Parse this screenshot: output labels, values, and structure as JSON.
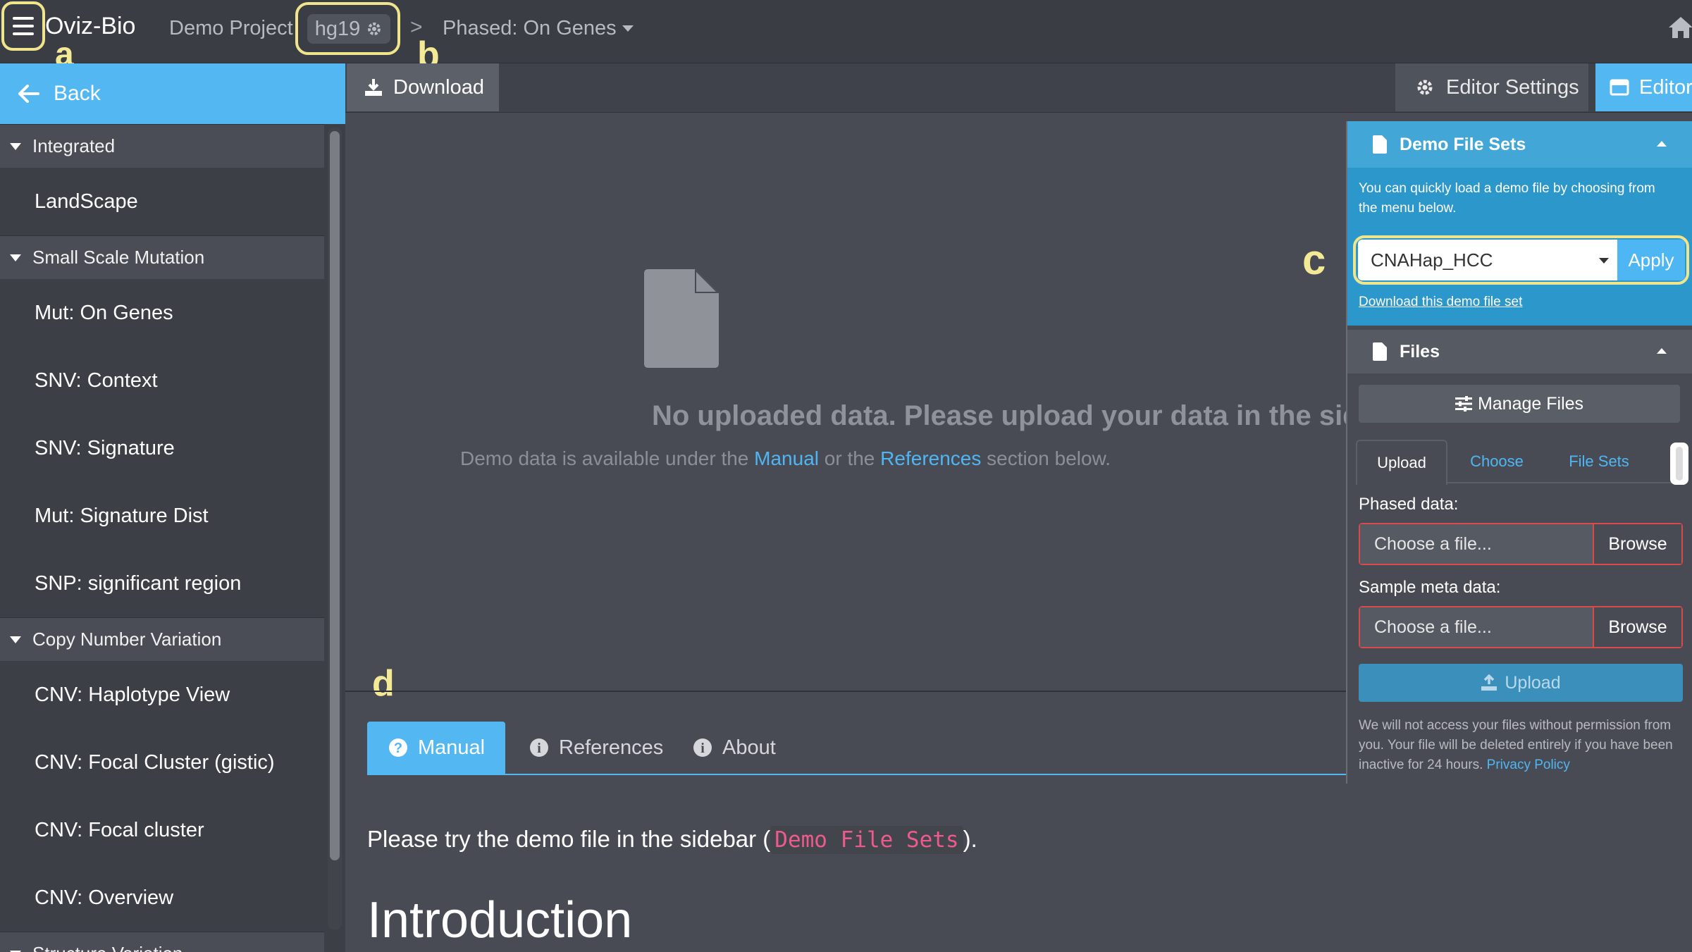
{
  "navbar": {
    "app_name": "Oviz-Bio",
    "project": "Demo Project",
    "genome": "hg19",
    "separator": ">",
    "view": "Phased: On Genes"
  },
  "annotations": {
    "a": "a",
    "b": "b",
    "c": "c",
    "d": "d"
  },
  "sidebar": {
    "back_label": "Back",
    "groups": [
      {
        "label": "Integrated",
        "items": [
          "LandScape"
        ]
      },
      {
        "label": "Small Scale Mutation",
        "items": [
          "Mut: On Genes",
          "SNV: Context",
          "SNV: Signature",
          "Mut: Signature Dist",
          "SNP: significant region"
        ]
      },
      {
        "label": "Copy Number Variation",
        "items": [
          "CNV: Haplotype View",
          "CNV: Focal Cluster (gistic)",
          "CNV: Focal cluster",
          "CNV: Overview"
        ]
      },
      {
        "label": "Structure Variation",
        "items": []
      }
    ]
  },
  "toolbar": {
    "download_label": "Download",
    "editor_settings_label": "Editor Settings",
    "editor_label": "Editor"
  },
  "empty_state": {
    "title": "No uploaded data. Please upload your data in the sidebar.",
    "sub_prefix": "Demo data is available under the ",
    "sub_link1": "Manual",
    "sub_middle": " or the ",
    "sub_link2": "References",
    "sub_suffix": " section below."
  },
  "doc": {
    "tabs": [
      "Manual",
      "References",
      "About"
    ],
    "sentence_prefix": "Please try the demo file in the sidebar (",
    "sentence_code": "Demo File Sets",
    "sentence_suffix": ").",
    "heading": "Introduction"
  },
  "demo_panel": {
    "title": "Demo File Sets",
    "description": "You can quickly load a demo file by choosing from the menu below.",
    "selected": "CNAHap_HCC",
    "apply_label": "Apply",
    "download_link": "Download this demo file set"
  },
  "files_panel": {
    "title": "Files",
    "manage_label": "Manage Files",
    "tabs": [
      "Upload",
      "Choose",
      "File Sets"
    ],
    "phased_label": "Phased data:",
    "phased_placeholder": "Choose a file...",
    "meta_label": "Sample meta data:",
    "meta_placeholder": "Choose a file...",
    "browse_label": "Browse",
    "upload_label": "Upload",
    "privacy_text": "We will not access your files without permission from you. Your file will be deleted entirely if you have been inactive for 24 hours. ",
    "privacy_link": "Privacy Policy"
  },
  "colors": {
    "accent": "#53b7f1",
    "highlight": "#f0e58d",
    "panel_blue": "#2b97ca",
    "error_border": "#d94b4b",
    "code_pink": "#ef5a8c"
  },
  "icons": [
    "menu-icon",
    "gear-icon",
    "chevron-right-icon",
    "caret-down-icon",
    "home-icon",
    "arrow-left-icon",
    "download-icon",
    "editor-icon",
    "file-icon",
    "question-icon",
    "info-icon",
    "sliders-icon",
    "upload-icon"
  ]
}
